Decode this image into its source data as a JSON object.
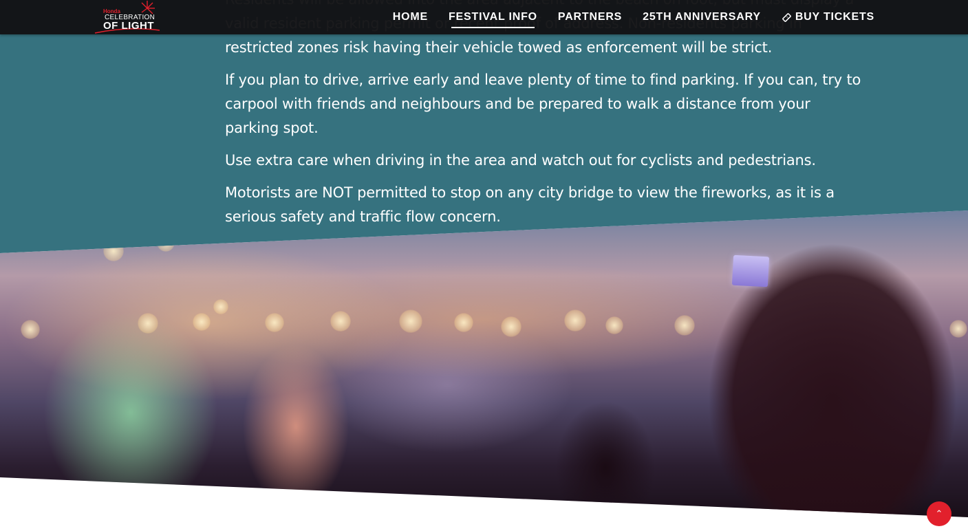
{
  "header": {
    "logo": {
      "brand": "Honda",
      "line1": "CELEBRATION",
      "line2": "OF LIGHT"
    },
    "nav": [
      {
        "label": "HOME",
        "active": false
      },
      {
        "label": "FESTIVAL INFO",
        "active": true
      },
      {
        "label": "PARTNERS",
        "active": false
      },
      {
        "label": "25TH ANNIVERSARY",
        "active": false
      },
      {
        "label": "BUY TICKETS",
        "active": false,
        "icon": "ticket-icon"
      }
    ]
  },
  "content": {
    "paragraphs": [
      "Residents will be allowed into the area adjacent to the beach on foot, but must display a valid resident parking permit or recent proof of address. Non-residents parking in restricted zones risk having their vehicle towed as enforcement will be strict.",
      "If you plan to drive, arrive early and leave plenty of time to find parking. If you can, try to carpool with friends and neighbours and be prepared to walk a distance from your parking spot.",
      "Use extra care when driving in the area and watch out for cyclists and pedestrians.",
      "Motorists are NOT permitted to stop on any city bridge to view the fireworks, as it is a serious safety and traffic flow concern."
    ]
  },
  "back_to_top": {
    "icon": "chevron-up-icon"
  },
  "colors": {
    "teal": "#36727f",
    "accent_red": "#e2202c",
    "header_bg": "#121214"
  }
}
